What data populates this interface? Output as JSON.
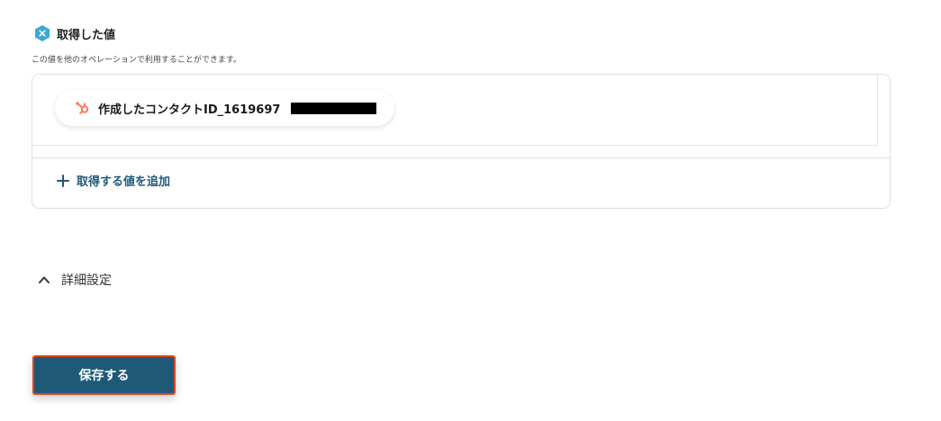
{
  "section": {
    "title": "取得した値",
    "description": "この値を他のオペレーションで利用することができます。",
    "icon": "x-hexagon-icon"
  },
  "values": [
    {
      "label": "作成したコンタクトID_1619697",
      "icon": "hubspot-icon",
      "redacted": true
    }
  ],
  "add_value": {
    "label": "取得する値を追加",
    "icon": "plus-icon"
  },
  "advanced": {
    "label": "詳細設定",
    "icon": "chevron-up-icon",
    "expanded": true
  },
  "save_button": {
    "label": "保存する"
  },
  "colors": {
    "primary": "#1e5a78",
    "hex_icon": "#3ba7d6",
    "hubspot": "#ff7a59",
    "save_outline": "#e0451e"
  }
}
